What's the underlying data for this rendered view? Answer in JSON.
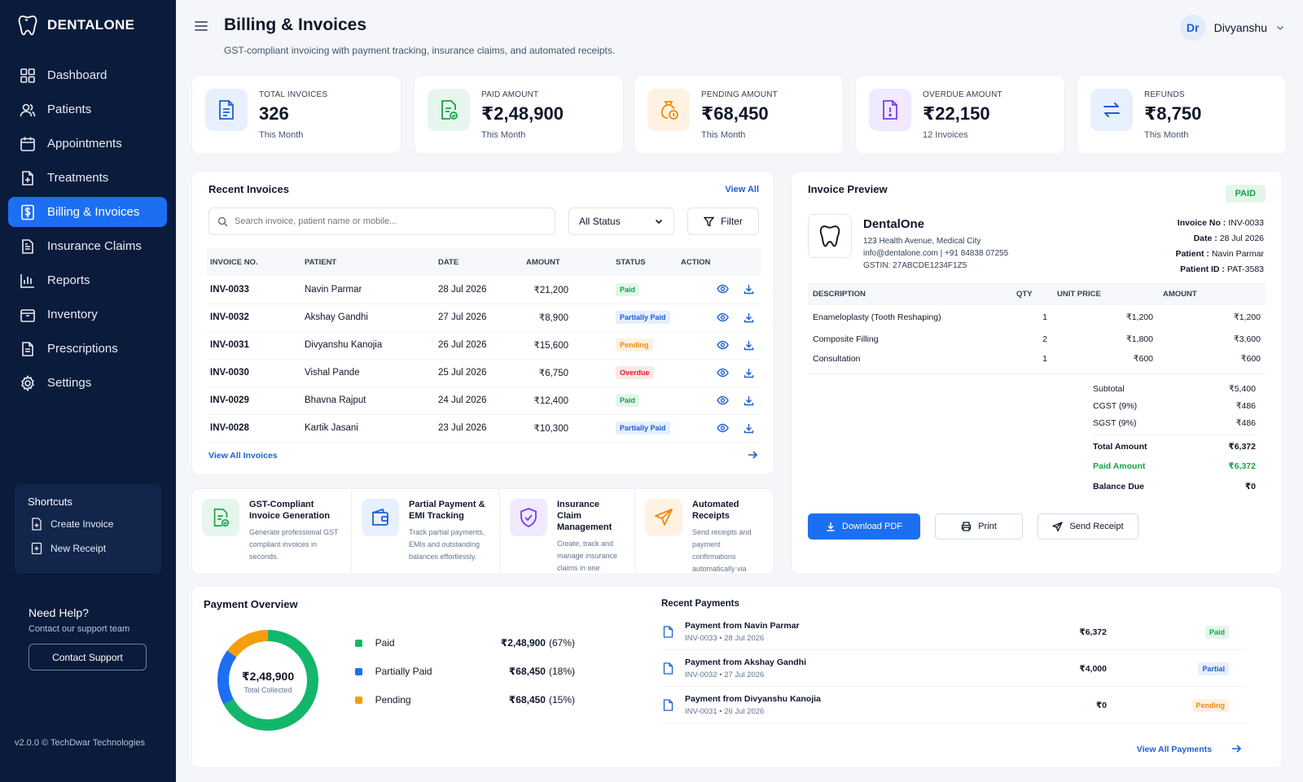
{
  "brand": {
    "name": "DENTALONE"
  },
  "sidebar": {
    "items": [
      {
        "label": "Dashboard",
        "icon": "grid-icon"
      },
      {
        "label": "Patients",
        "icon": "users-icon"
      },
      {
        "label": "Appointments",
        "icon": "calendar-icon"
      },
      {
        "label": "Treatments",
        "icon": "file-plus-icon"
      },
      {
        "label": "Billing & Invoices",
        "icon": "dollar-file-icon"
      },
      {
        "label": "Insurance Claims",
        "icon": "clipboard-icon"
      },
      {
        "label": "Reports",
        "icon": "bar-chart-icon"
      },
      {
        "label": "Inventory",
        "icon": "box-icon"
      },
      {
        "label": "Prescriptions",
        "icon": "document-icon"
      },
      {
        "label": "Settings",
        "icon": "gear-icon"
      }
    ],
    "active": "Billing & Invoices",
    "shortcuts": {
      "title": "Shortcuts",
      "items": [
        "Create Invoice",
        "New Receipt"
      ]
    },
    "help": {
      "title": "Need Help?",
      "subtitle": "Contact our support team",
      "button": "Contact Support"
    },
    "version": "v2.0.0 © TechDwar Technologies"
  },
  "header": {
    "title": "Billing & Invoices",
    "subtitle": "GST-compliant invoicing with payment tracking, insurance claims, and automated receipts.",
    "user": {
      "initials": "Dr",
      "name": "Divyanshu"
    }
  },
  "stats": [
    {
      "label": "TOTAL INVOICES",
      "value": "326",
      "sub": "This Month",
      "color": "#1d5fd6",
      "bg": "#e8f0fd"
    },
    {
      "label": "PAID AMOUNT",
      "value": "₹2,48,900",
      "sub": "This Month",
      "color": "#16a34a",
      "bg": "#e6f6ec"
    },
    {
      "label": "PENDING AMOUNT",
      "value": "₹68,450",
      "sub": "This Month",
      "color": "#f08a0b",
      "bg": "#fff2e3"
    },
    {
      "label": "OVERDUE AMOUNT",
      "value": "₹22,150",
      "sub": "12 Invoices",
      "color": "#7c3aed",
      "bg": "#f1e9fd"
    },
    {
      "label": "REFUNDS",
      "value": "₹8,750",
      "sub": "This Month",
      "color": "#1d5fd6",
      "bg": "#e8f0fd"
    }
  ],
  "recent_invoices": {
    "title": "Recent Invoices",
    "view_all": "View All",
    "search_placeholder": "Search invoice, patient name or mobile...",
    "status_filter": "All Status",
    "filter_label": "Filter",
    "columns": [
      "INVOICE NO.",
      "PATIENT",
      "DATE",
      "AMOUNT",
      "STATUS",
      "ACTION"
    ],
    "rows": [
      {
        "no": "INV-0033",
        "patient": "Navin Parmar",
        "date": "28 Jul 2026",
        "amount": "₹21,200",
        "status": "Paid",
        "cls": "b-paid"
      },
      {
        "no": "INV-0032",
        "patient": "Akshay Gandhi",
        "date": "27 Jul 2026",
        "amount": "₹8,900",
        "status": "Partially Paid",
        "cls": "b-partial"
      },
      {
        "no": "INV-0031",
        "patient": "Divyanshu Kanojia",
        "date": "26 Jul 2026",
        "amount": "₹15,600",
        "status": "Pending",
        "cls": "b-pending"
      },
      {
        "no": "INV-0030",
        "patient": "Vishal Pande",
        "date": "25 Jul 2026",
        "amount": "₹6,750",
        "status": "Overdue",
        "cls": "b-overdue"
      },
      {
        "no": "INV-0029",
        "patient": "Bhavna Rajput",
        "date": "24 Jul 2026",
        "amount": "₹12,400",
        "status": "Paid",
        "cls": "b-paid"
      },
      {
        "no": "INV-0028",
        "patient": "Kartik Jasani",
        "date": "23 Jul 2026",
        "amount": "₹10,300",
        "status": "Partially Paid",
        "cls": "b-partial"
      }
    ],
    "footer_link": "View All Invoices"
  },
  "features": [
    {
      "title": "GST-Compliant Invoice Generation",
      "desc": "Generate professional GST compliant invoices in seconds.",
      "color": "#16a34a",
      "bg": "#e6f6ec"
    },
    {
      "title": "Partial Payment & EMI Tracking",
      "desc": "Track partial payments, EMIs and outstanding balances effortlessly.",
      "color": "#1d5fd6",
      "bg": "#e8f0fd"
    },
    {
      "title": "Insurance Claim Management",
      "desc": "Create, track and manage insurance claims in one seamless flow.",
      "color": "#7c3aed",
      "bg": "#f1e9fd"
    },
    {
      "title": "Automated Receipts",
      "desc": "Send receipts and payment confirmations automatically via Email & SMS.",
      "color": "#f08a0b",
      "bg": "#fff2e3"
    }
  ],
  "invoice_preview": {
    "title": "Invoice Preview",
    "status": "PAID",
    "clinic": {
      "name": "DentalOne",
      "address": "123 Health Avenue, Medical City",
      "contact": "info@dentalone.com | +91 84838 07255",
      "gstin": "GSTIN: 27ABCDE1234F1Z5"
    },
    "meta": [
      {
        "label": "Invoice No :",
        "value": "INV-0033"
      },
      {
        "label": "Date :",
        "value": "28 Jul 2026"
      },
      {
        "label": "Patient :",
        "value": "Navin Parmar"
      },
      {
        "label": "Patient ID :",
        "value": "PAT-3583"
      }
    ],
    "columns": [
      "DESCRIPTION",
      "QTY",
      "UNIT PRICE",
      "AMOUNT"
    ],
    "items": [
      {
        "desc": "Enameloplasty (Tooth Reshaping)",
        "qty": "1",
        "unit": "₹1,200",
        "amount": "₹1,200"
      },
      {
        "desc": "Composite Filling",
        "qty": "2",
        "unit": "₹1,800",
        "amount": "₹3,600"
      },
      {
        "desc": "Consultation",
        "qty": "1",
        "unit": "₹600",
        "amount": "₹600"
      }
    ],
    "totals": [
      {
        "label": "Subtotal",
        "value": "₹5,400"
      },
      {
        "label": "CGST (9%)",
        "value": "₹486"
      },
      {
        "label": "SGST (9%)",
        "value": "₹486"
      }
    ],
    "total_amount": {
      "label": "Total Amount",
      "value": "₹6,372"
    },
    "paid_amount": {
      "label": "Paid Amount",
      "value": "₹6,372"
    },
    "balance_due": {
      "label": "Balance Due",
      "value": "₹0"
    },
    "buttons": {
      "download": "Download PDF",
      "print": "Print",
      "send": "Send Receipt"
    }
  },
  "payment_overview": {
    "title": "Payment Overview",
    "center_value": "₹2,48,900",
    "center_label": "Total Collected",
    "legend": [
      {
        "label": "Paid",
        "value": "₹2,48,900",
        "pct": "(67%)",
        "color": "#12b76a",
        "share": 67
      },
      {
        "label": "Partially Paid",
        "value": "₹68,450",
        "pct": "(18%)",
        "color": "#1d6ff2",
        "share": 18
      },
      {
        "label": "Pending",
        "value": "₹68,450",
        "pct": "(15%)",
        "color": "#f59e0b",
        "share": 15
      }
    ]
  },
  "recent_payments": {
    "title": "Recent Payments",
    "rows": [
      {
        "title": "Payment from Navin Parmar",
        "sub": "INV-0033 • 28 Jul 2026",
        "amount": "₹6,372",
        "status": "Paid",
        "cls": "b-paid"
      },
      {
        "title": "Payment from Akshay Gandhi",
        "sub": "INV-0032 • 27 Jul 2026",
        "amount": "₹4,000",
        "status": "Partial",
        "cls": "b-partial"
      },
      {
        "title": "Payment from Divyanshu Kanojia",
        "sub": "INV-0031 • 26 Jul 2026",
        "amount": "₹0",
        "status": "Pending",
        "cls": "b-pending"
      }
    ],
    "view_all": "View All Payments"
  }
}
